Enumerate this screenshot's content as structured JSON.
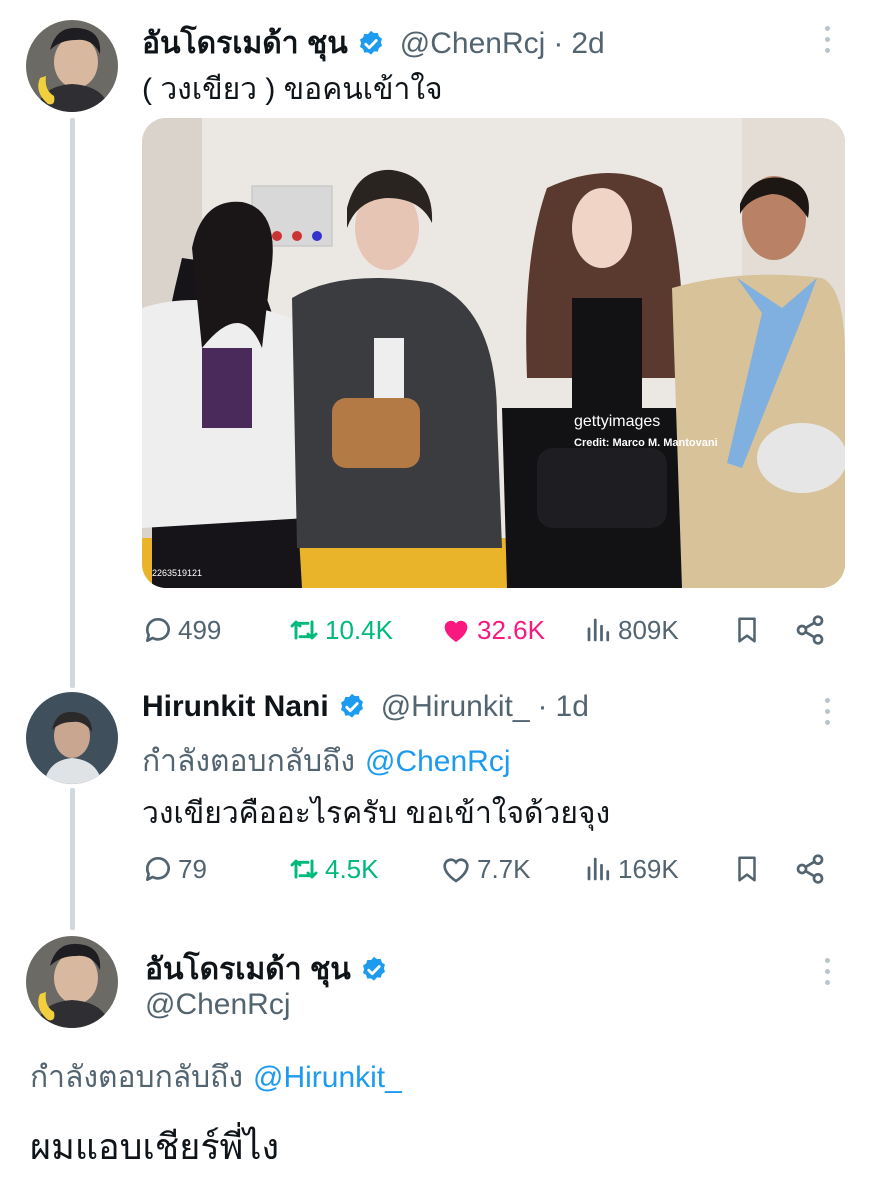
{
  "tweets": [
    {
      "display_name": "อันโดรเมด้า ชุน",
      "handle": "@ChenRcj",
      "separator": "·",
      "time": "2d",
      "text": "( วงเขียว ) ขอคนเข้าใจ",
      "media": {
        "watermark_brand": "gettyimages",
        "watermark_credit": "Credit: Marco M. Mantovani",
        "image_id": "2263519121"
      },
      "stats": {
        "replies": "499",
        "retweets": "10.4K",
        "likes": "32.6K",
        "views": "809K"
      },
      "liked": true
    },
    {
      "display_name": "Hirunkit Nani",
      "handle": "@Hirunkit_",
      "separator": "·",
      "time": "1d",
      "replying_prefix": "กำลังตอบกลับถึง",
      "replying_to": "@ChenRcj",
      "text": "วงเขียวคืออะไรครับ ขอเข้าใจด้วยจุง",
      "stats": {
        "replies": "79",
        "retweets": "4.5K",
        "likes": "7.7K",
        "views": "169K"
      },
      "liked": false
    },
    {
      "display_name": "อันโดรเมด้า ชุน",
      "handle": "@ChenRcj",
      "replying_prefix": "กำลังตอบกลับถึง",
      "replying_to": "@Hirunkit_",
      "text": "ผมแอบเชียร์พี่ไง"
    }
  ],
  "colors": {
    "accent": "#1d9bf0",
    "retweet": "#00ba7c",
    "like": "#f91880",
    "muted": "#536471",
    "thread": "#cfd9de"
  },
  "icons": [
    "verified-badge-icon",
    "more-options-icon",
    "reply-icon",
    "retweet-icon",
    "like-icon",
    "views-icon",
    "bookmark-icon",
    "share-icon"
  ]
}
